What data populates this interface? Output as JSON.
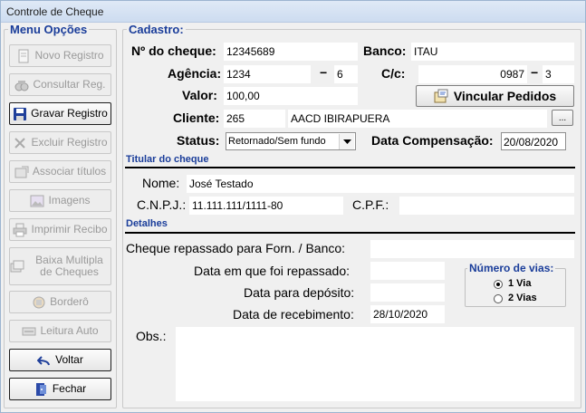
{
  "window": {
    "title": "Controle de Cheque"
  },
  "menu": {
    "legend": "Menu Opções",
    "buttons": [
      {
        "label": "Novo Registro",
        "icon": "new-document-icon",
        "enabled": false
      },
      {
        "label": "Consultar Reg.",
        "icon": "binoculars-icon",
        "enabled": false
      },
      {
        "label": "Gravar Registro",
        "icon": "floppy-disk-icon",
        "enabled": true
      },
      {
        "label": "Excluir Registro",
        "icon": "x-delete-icon",
        "enabled": false
      },
      {
        "label": "Associar títulos",
        "icon": "associate-icon",
        "enabled": false
      },
      {
        "label": "Imagens",
        "icon": "image-icon",
        "enabled": false
      },
      {
        "label": "Imprimir Recibo",
        "icon": "printer-icon",
        "enabled": false
      },
      {
        "label": "Baixa Multipla de Cheques",
        "icon": "batch-icon",
        "enabled": false
      },
      {
        "label": "Borderô",
        "icon": "bordero-icon",
        "enabled": false
      },
      {
        "label": "Leitura Auto",
        "icon": "scanner-icon",
        "enabled": false
      },
      {
        "label": "Voltar",
        "icon": "undo-arrow-icon",
        "enabled": true
      },
      {
        "label": "Fechar",
        "icon": "exit-door-icon",
        "enabled": true
      }
    ]
  },
  "cadastro": {
    "legend": "Cadastro:",
    "labels": {
      "numero_cheque": "Nº do cheque:",
      "banco": "Banco:",
      "agencia": "Agência:",
      "cc": "C/c:",
      "valor": "Valor:",
      "cliente": "Cliente:",
      "status": "Status:",
      "data_compensacao": "Data Compensação:",
      "dash": "−"
    },
    "values": {
      "numero_cheque": "12345689",
      "banco": "ITAU",
      "agencia": "1234",
      "agencia_digito": "6",
      "cc": "0987",
      "cc_digito": "3",
      "valor": "100,00",
      "cliente_codigo": "265",
      "cliente_nome": "AACD IBIRAPUERA",
      "status": "Retornado/Sem fundo",
      "data_compensacao": "20/08/2020"
    },
    "vincular_button": "Vincular Pedidos",
    "ellipsis_button": "..."
  },
  "titular": {
    "section_title": "Titular do cheque",
    "labels": {
      "nome": "Nome:",
      "cnpj": "C.N.P.J.:",
      "cpf": "C.P.F.:"
    },
    "values": {
      "nome": "José Testado",
      "cnpj": "11.111.111/1111-80",
      "cpf": ""
    }
  },
  "detalhes": {
    "section_title": "Detalhes",
    "labels": {
      "repassado_para": "Cheque repassado para Forn. / Banco:",
      "data_repasse": "Data em que foi repassado:",
      "data_deposito": "Data para depósito:",
      "data_recebimento": "Data de recebimento:",
      "obs": "Obs.:"
    },
    "values": {
      "repassado_para": "",
      "data_repasse": "",
      "data_deposito": "",
      "data_recebimento": "28/10/2020",
      "obs": ""
    },
    "vias": {
      "legend": "Número de vias:",
      "options": [
        "1 Via",
        "2 Vias"
      ],
      "selected": "1 Via"
    }
  },
  "colors": {
    "accent": "#1a3d9a",
    "title_bar": "#dfe9f6",
    "background": "#f0f0f0"
  }
}
